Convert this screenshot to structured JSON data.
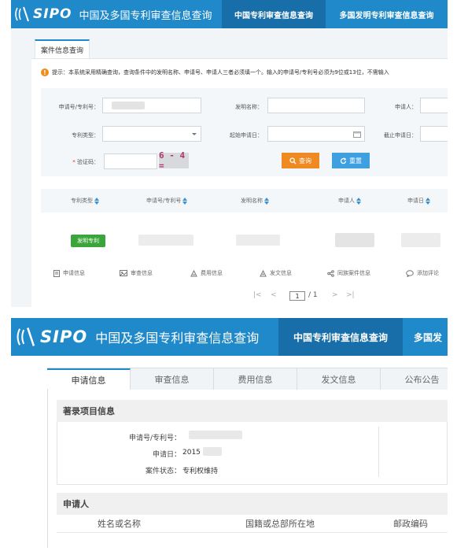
{
  "header": {
    "logo_text": "SIPO",
    "site_title": "中国及多国专利审查信息查询",
    "nav_tabs": [
      "中国专利审查信息查询",
      "多国发明专利审查信息查询"
    ],
    "nav_tab_short": "多国发",
    "brand_color": "#1f89c9"
  },
  "search": {
    "tab_label": "案件信息查询",
    "tip": "提示：本系统采用精确查询，查询条件中的发明名称、申请号、申请人三者必须填一个。输入的申请号/专利号必须为9位或13位，不需输入",
    "labels": {
      "app_no": "申请号/专利号：",
      "title": "发明名称：",
      "applicant": "申请人：",
      "type": "专利类型：",
      "start_date": "起始申请日：",
      "end_date": "截止申请日：",
      "captcha": "验证码："
    },
    "required_mark": "*",
    "captcha_text": "6 - 4 =",
    "query_button": "查询",
    "reset_button": "重置"
  },
  "results": {
    "columns": [
      "专利类型",
      "申请号/专利号",
      "发明名称",
      "申请人",
      "申请日"
    ],
    "row_badge": "发明专利",
    "actions": [
      "申请信息",
      "审查信息",
      "费用信息",
      "发文信息",
      "同族案件信息",
      "添加评论"
    ],
    "pagination": {
      "current": "1",
      "total": "/ 1"
    }
  },
  "detail": {
    "tabs": [
      "申请信息",
      "审查信息",
      "费用信息",
      "发文信息",
      "公布公告"
    ],
    "section1_title": "著录项目信息",
    "fields": [
      {
        "label": "申请号/专利号：",
        "value": ""
      },
      {
        "label": "申请日：",
        "value": "2015"
      },
      {
        "label": "案件状态：",
        "value": "专利权维持"
      }
    ],
    "section2_title": "申请人",
    "applicant_columns": [
      "姓名或名称",
      "国籍或总部所在地",
      "邮政编码"
    ]
  }
}
